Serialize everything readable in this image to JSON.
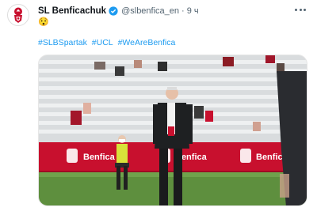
{
  "tweet": {
    "display_name": "SL Benficachuk",
    "handle": "@slbenfica_en",
    "separator": "·",
    "time": "9 ч",
    "emoji": "😯",
    "hashtags": [
      "#SLBSpartak",
      "#UCL",
      "#WeAreBenfica"
    ],
    "banner_text": [
      "Benfica",
      "Benfica",
      "Benfica"
    ]
  },
  "colors": {
    "hashtag": "#1d9bf0",
    "verified": "#1d9bf0",
    "banner_red": "#c8102e"
  },
  "icons": [
    "benfica-crest-icon",
    "verified-badge-icon",
    "more-options-icon"
  ]
}
